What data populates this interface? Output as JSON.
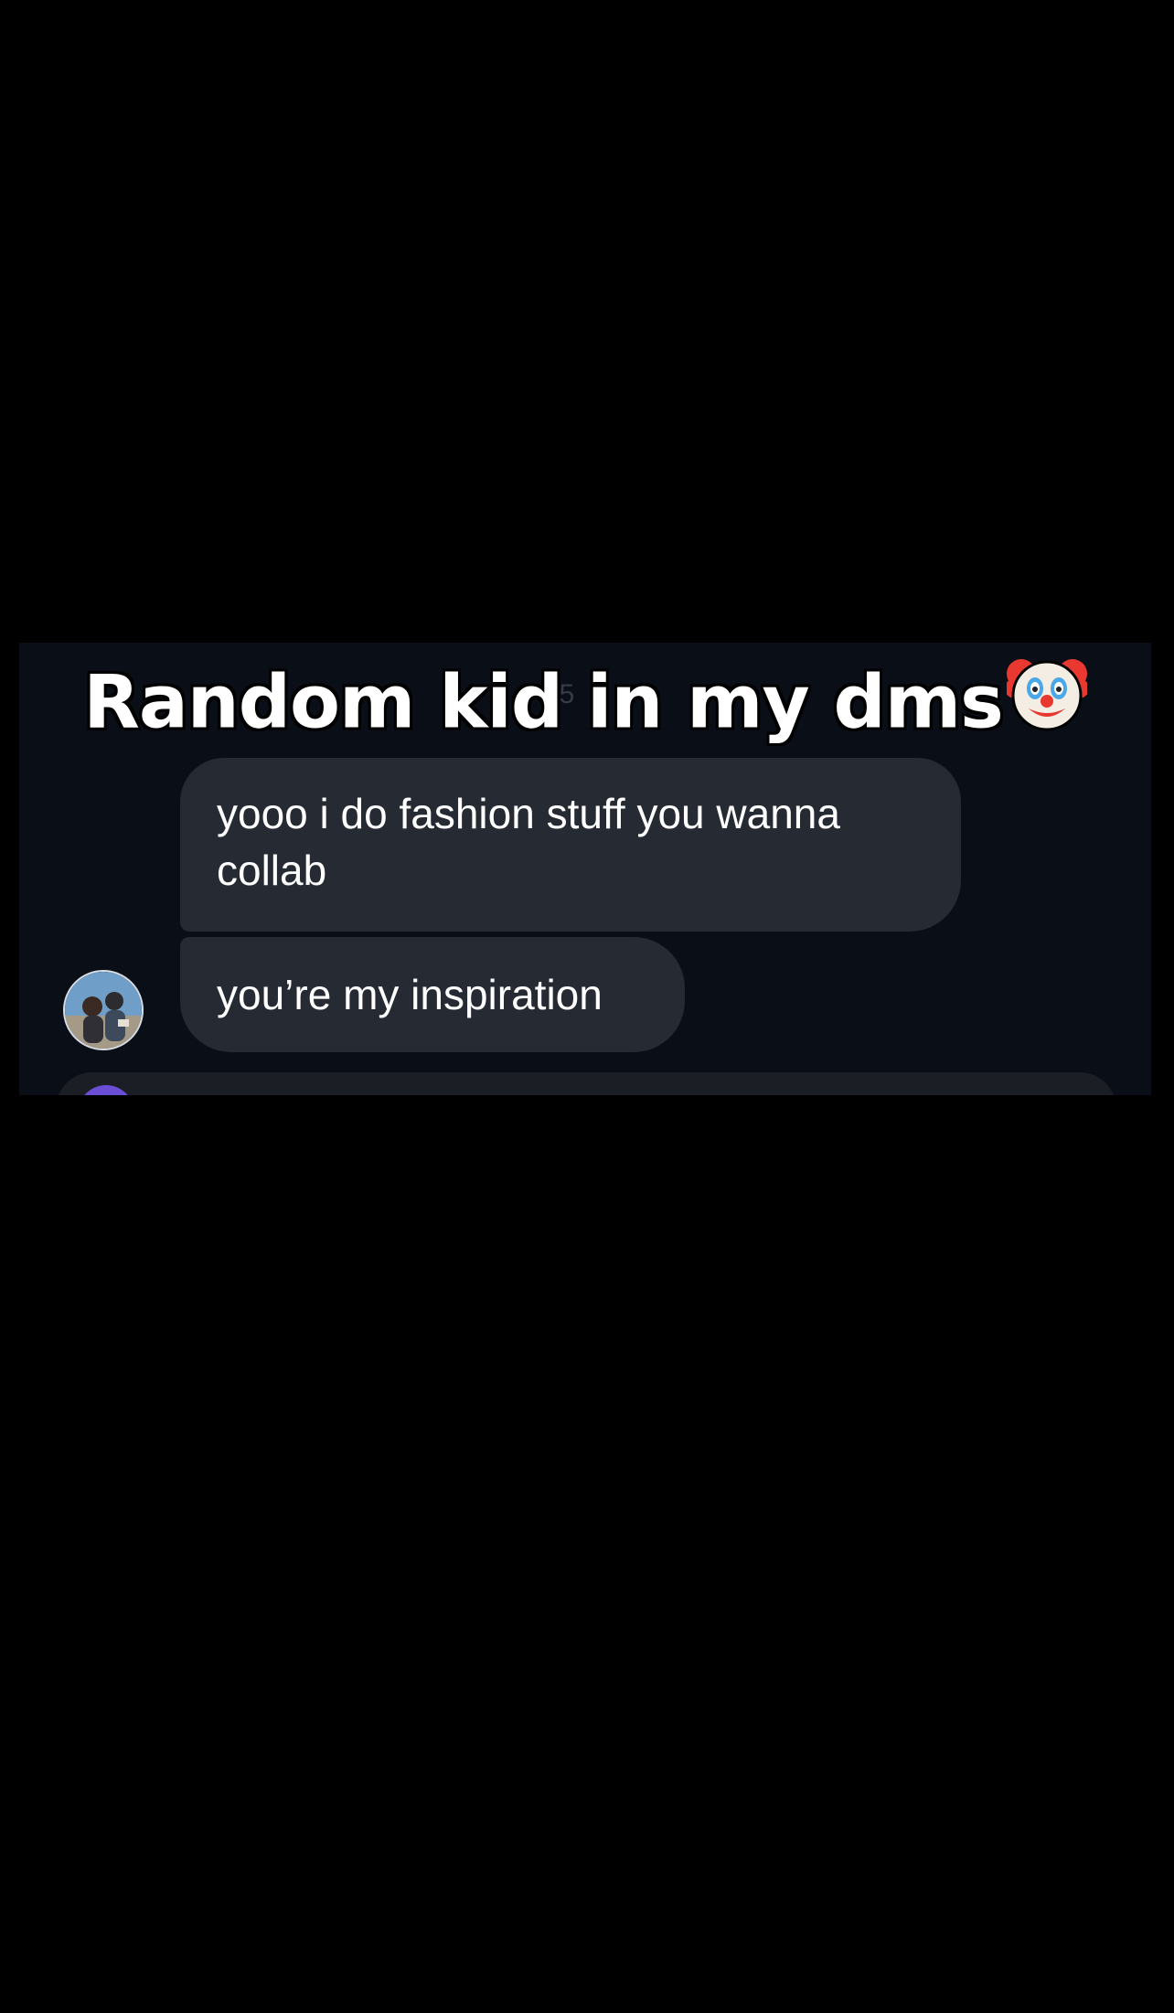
{
  "overlay": {
    "caption": "Random kid in my dms",
    "caption_emoji": "clown-face-icon"
  },
  "chat": {
    "timestamp_fragment": "35",
    "messages": [
      {
        "text": "yooo i do fashion stuff you wanna collab"
      },
      {
        "text": "you’re my inspiration"
      }
    ],
    "sender_avatar": "avatar"
  },
  "colors": {
    "background": "#000000",
    "panel": "#0a0e17",
    "bubble": "#262a33",
    "text": "#ffffff",
    "composer_avatar": "#6a4fd6"
  }
}
